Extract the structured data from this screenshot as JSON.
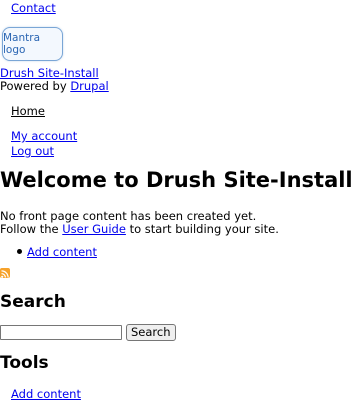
{
  "nav_top": {
    "contact": "Contact"
  },
  "branding": {
    "logo_alt": "Mantra logo",
    "site_name": "Drush Site-Install",
    "powered_by_prefix": "Powered by",
    "powered_by_link": "Drupal"
  },
  "main_menu": {
    "home": "Home"
  },
  "account_menu": {
    "my_account": "My account",
    "log_out": "Log out"
  },
  "page": {
    "title": "Welcome to Drush Site-Install",
    "intro": "No front page content has been created yet.",
    "follow_prefix": "Follow the",
    "user_guide_link": "User Guide",
    "follow_suffix": "to start building your site.",
    "actions": [
      "Add content"
    ]
  },
  "search": {
    "heading": "Search",
    "input_value": "",
    "button": "Search"
  },
  "tools": {
    "heading": "Tools",
    "items": [
      "Add content"
    ]
  },
  "colors": {
    "link": "#0000ee",
    "rss": "#f6a22b",
    "logo_border": "#7aa6d6"
  }
}
